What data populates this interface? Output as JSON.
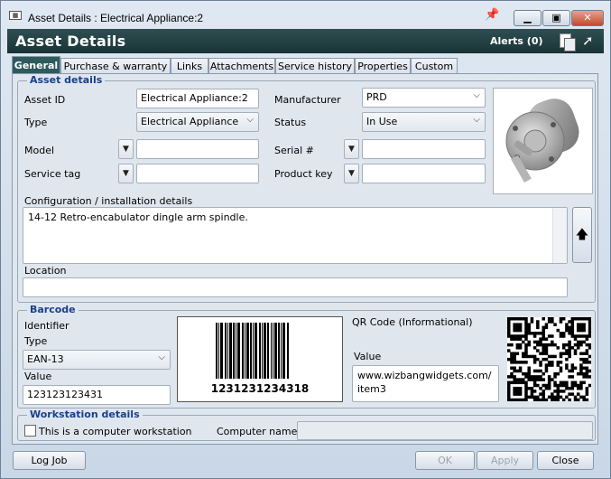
{
  "window": {
    "title": "Asset Details : Electrical Appliance:2",
    "app_icon": "window-icon",
    "pin_icon": "pin-icon",
    "minimize_icon": "minimize-icon",
    "maximize_icon": "maximize-icon",
    "close_icon": "close-icon"
  },
  "header": {
    "title": "Asset Details",
    "alerts_label": "Alerts (0)",
    "icons": [
      "copy-icon",
      "pointer-icon"
    ],
    "bg_color": "#22413f"
  },
  "tabs": [
    {
      "label": "General",
      "active": true
    },
    {
      "label": "Purchase & warranty",
      "active": false
    },
    {
      "label": "Links",
      "active": false
    },
    {
      "label": "Attachments",
      "active": false
    },
    {
      "label": "Service history",
      "active": false
    },
    {
      "label": "Properties",
      "active": false
    },
    {
      "label": "Custom",
      "active": false
    }
  ],
  "asset_details": {
    "legend": "Asset details",
    "asset_id_label": "Asset ID",
    "asset_id_value": "Electrical Appliance:2",
    "type_label": "Type",
    "type_value": "Electrical Appliance",
    "manufacturer_label": "Manufacturer",
    "manufacturer_value": "PRD",
    "status_label": "Status",
    "status_value": "In Use",
    "model_label": "Model",
    "model_value": "",
    "serial_label": "Serial #",
    "serial_value": "",
    "service_tag_label": "Service tag",
    "service_tag_value": "",
    "product_key_label": "Product key",
    "product_key_value": "",
    "config_label": "Configuration / installation details",
    "config_value": "14-12 Retro-encabulator dingle arm spindle.",
    "location_label": "Location",
    "location_value": "",
    "upload_icon": "arrow-up-icon"
  },
  "barcode": {
    "legend": "Barcode",
    "identifier_label": "Identifier",
    "type_label": "Type",
    "type_value": "EAN-13",
    "value_label": "Value",
    "value_value": "123123123431",
    "barcode_text": "1231231234318",
    "qr_label": "QR Code (Informational)",
    "qr_value_label": "Value",
    "qr_value": "www.wizbangwidgets.com/item3"
  },
  "workstation": {
    "legend": "Workstation details",
    "checkbox_label": "This is a computer workstation",
    "checked": false,
    "computer_name_label": "Computer name:",
    "computer_name_value": ""
  },
  "footer": {
    "log_job": "Log Job",
    "ok": "OK",
    "apply": "Apply",
    "close": "Close"
  }
}
